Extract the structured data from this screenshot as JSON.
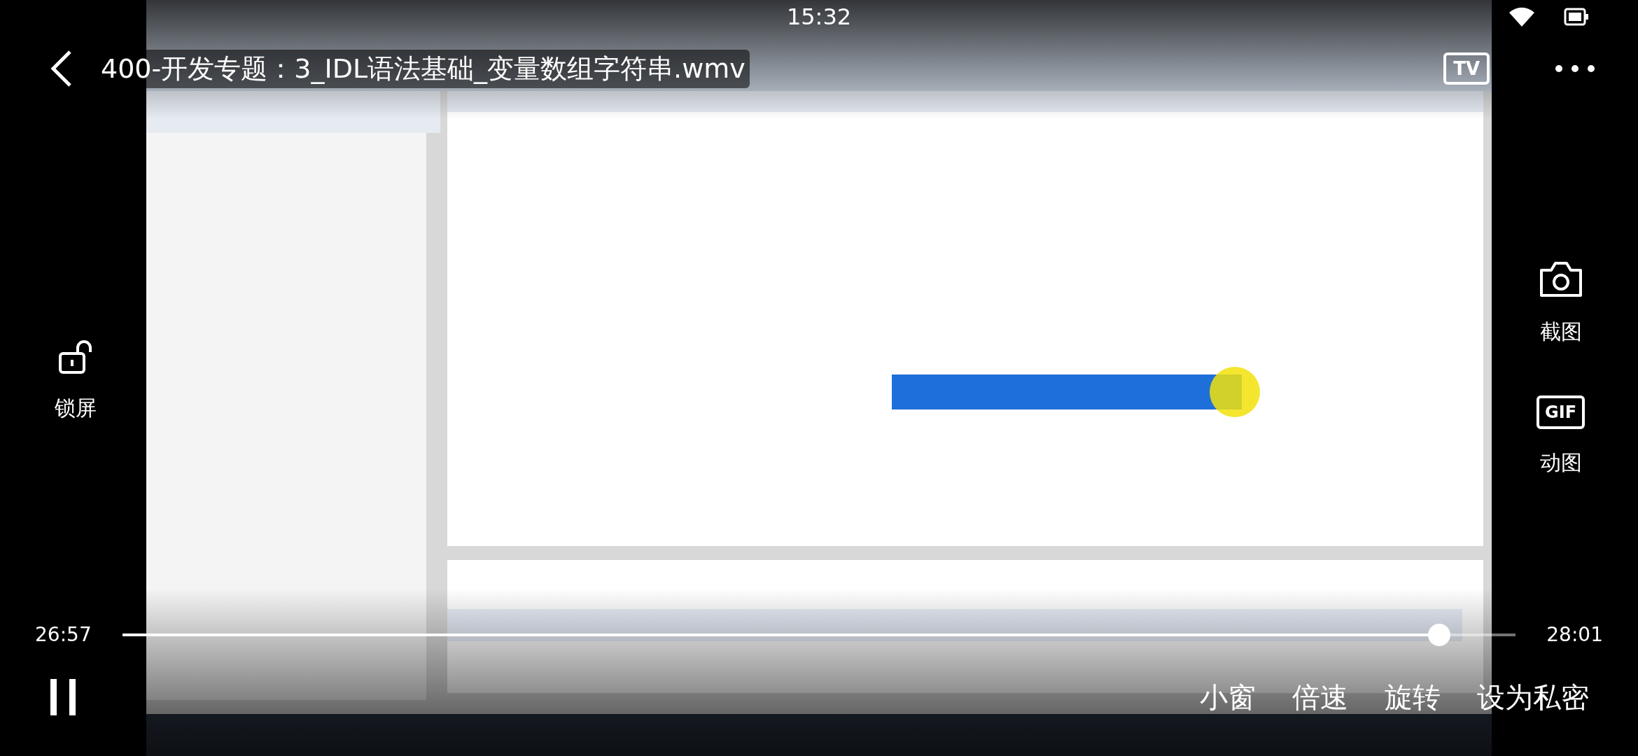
{
  "status_bar": {
    "time": "15:32"
  },
  "header": {
    "title": "400-开发专题：3_IDL语法基础_变量数组字符串.wmv",
    "tv_label": "TV"
  },
  "left_tools": [
    {
      "kind": "lock",
      "label": "锁屏"
    }
  ],
  "right_tools": [
    {
      "kind": "screenshot",
      "label": "截图"
    },
    {
      "kind": "gif",
      "label": "动图",
      "badge": "GIF"
    }
  ],
  "progress": {
    "elapsed": "26:57",
    "total": "28:01",
    "level": 0.945
  },
  "playback": {
    "playing": true
  },
  "buttons": [
    "小窗",
    "倍速",
    "旋转",
    "设为私密"
  ]
}
